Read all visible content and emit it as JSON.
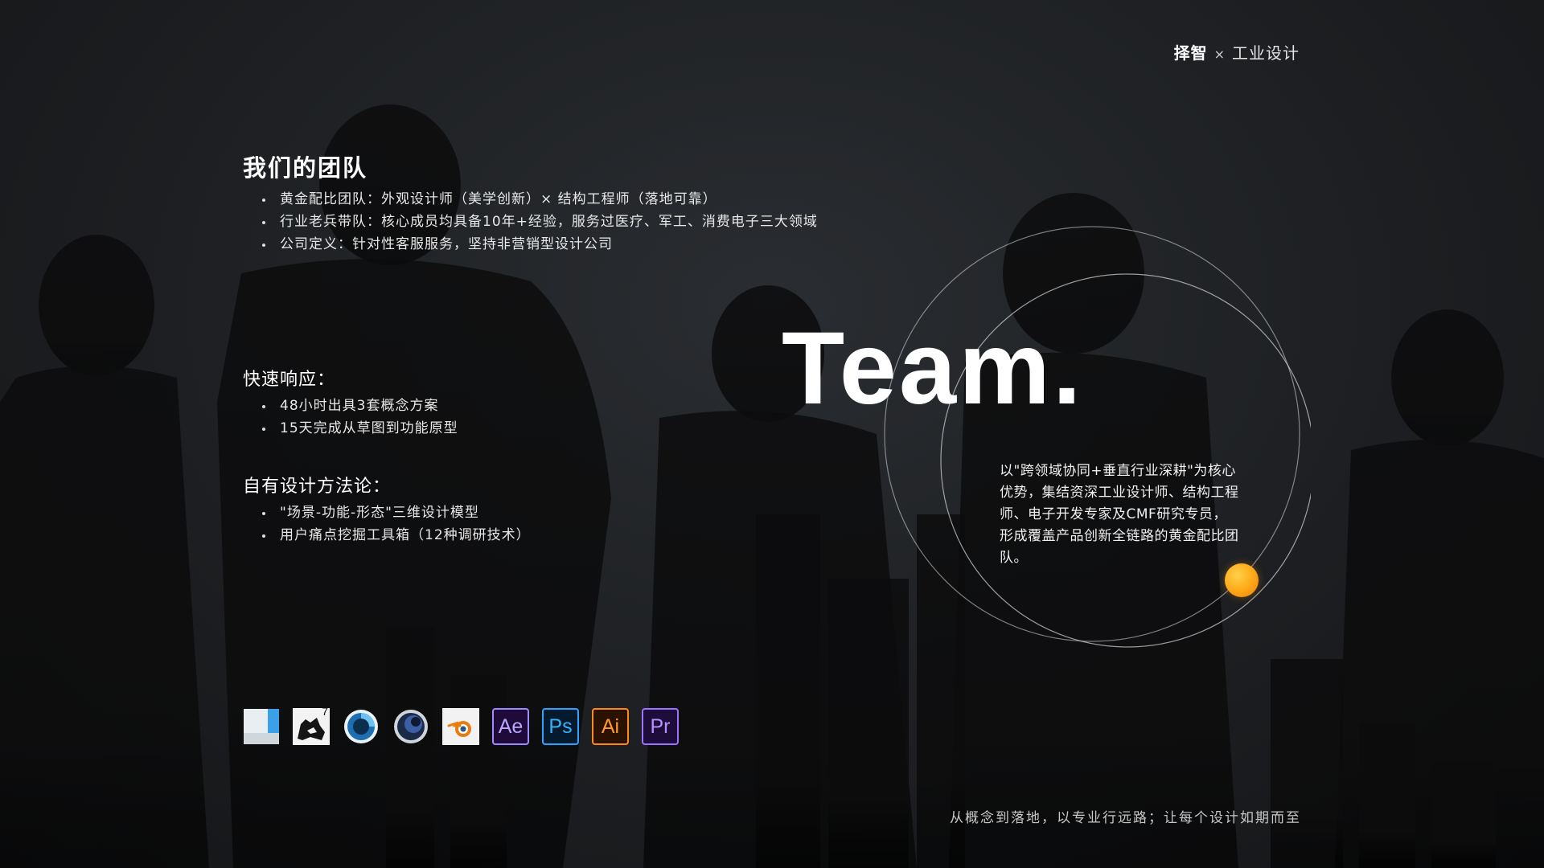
{
  "brand": {
    "name": "择智",
    "separator": "×",
    "suffix": "工业设计"
  },
  "team_section": {
    "title": "我们的团队",
    "bullets": [
      "黄金配比团队：外观设计师（美学创新）× 结构工程师（落地可靠）",
      "行业老兵带队：核心成员均具备10年+经验，服务过医疗、军工、消费电子三大领域",
      "公司定义：针对性客服服务，坚持非营销型设计公司"
    ]
  },
  "fast_response": {
    "title": "快速响应：",
    "bullets": [
      "48小时出具3套概念方案",
      "15天完成从草图到功能原型"
    ]
  },
  "methodology": {
    "title": "自有设计方法论：",
    "bullets": [
      "\"场景-功能-形态\"三维设计模型",
      "用户痛点挖掘工具箱（12种调研技术）"
    ]
  },
  "headline": "Team.",
  "description": "以\"跨领域协同+垂直行业深耕\"为核心优势，集结资深工业设计师、结构工程师、电子开发专家及CMF研究专员，形成覆盖产品创新全链路的黄金配比团队。",
  "tools": [
    {
      "icon": "solidworks-icon",
      "label": ""
    },
    {
      "icon": "rhino-7-icon",
      "label": "7"
    },
    {
      "icon": "keyshot-icon",
      "label": ""
    },
    {
      "icon": "cinema-4d-icon",
      "label": ""
    },
    {
      "icon": "blender-icon",
      "label": ""
    },
    {
      "icon": "after-effects-icon",
      "label": "Ae"
    },
    {
      "icon": "photoshop-icon",
      "label": "Ps"
    },
    {
      "icon": "illustrator-icon",
      "label": "Ai"
    },
    {
      "icon": "premiere-pro-icon",
      "label": "Pr"
    }
  ],
  "tagline": "从概念到落地，以专业行远路；让每个设计如期而至",
  "colors": {
    "background": "#191a1c",
    "accent_orb": "#ffae1d",
    "text": "#ffffff"
  }
}
